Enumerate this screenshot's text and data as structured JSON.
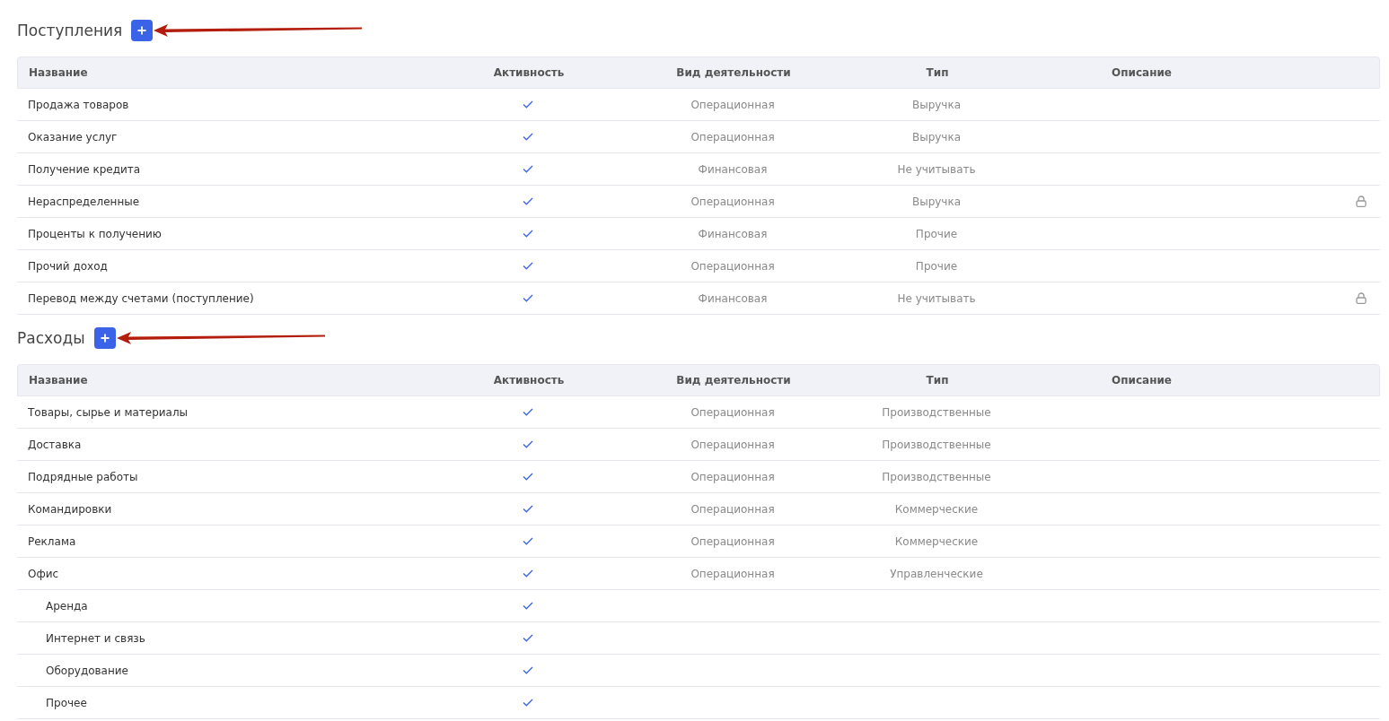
{
  "sections": [
    {
      "title": "Поступления",
      "columns": [
        "Название",
        "Активность",
        "Вид деятельности",
        "Тип",
        "Описание"
      ],
      "rows": [
        {
          "name": "Продажа товаров",
          "active": true,
          "activity": "Операционная",
          "type": "Выручка",
          "locked": false
        },
        {
          "name": "Оказание услуг",
          "active": true,
          "activity": "Операционная",
          "type": "Выручка",
          "locked": false
        },
        {
          "name": "Получение кредита",
          "active": true,
          "activity": "Финансовая",
          "type": "Не учитывать",
          "locked": false
        },
        {
          "name": "Нераспределенные",
          "active": true,
          "activity": "Операционная",
          "type": "Выручка",
          "locked": true
        },
        {
          "name": "Проценты к получению",
          "active": true,
          "activity": "Финансовая",
          "type": "Прочие",
          "locked": false
        },
        {
          "name": "Прочий доход",
          "active": true,
          "activity": "Операционная",
          "type": "Прочие",
          "locked": false
        },
        {
          "name": "Перевод между счетами (поступление)",
          "active": true,
          "activity": "Финансовая",
          "type": "Не учитывать",
          "locked": true
        }
      ]
    },
    {
      "title": "Расходы",
      "columns": [
        "Название",
        "Активность",
        "Вид деятельности",
        "Тип",
        "Описание"
      ],
      "rows": [
        {
          "name": "Товары, сырье и материалы",
          "active": true,
          "activity": "Операционная",
          "type": "Производственные",
          "locked": false
        },
        {
          "name": "Доставка",
          "active": true,
          "activity": "Операционная",
          "type": "Производственные",
          "locked": false
        },
        {
          "name": "Подрядные работы",
          "active": true,
          "activity": "Операционная",
          "type": "Производственные",
          "locked": false
        },
        {
          "name": "Командировки",
          "active": true,
          "activity": "Операционная",
          "type": "Коммерческие",
          "locked": false
        },
        {
          "name": "Реклама",
          "active": true,
          "activity": "Операционная",
          "type": "Коммерческие",
          "locked": false
        },
        {
          "name": "Офис",
          "active": true,
          "activity": "Операционная",
          "type": "Управленческие",
          "locked": false,
          "children": [
            {
              "name": "Аренда",
              "active": true,
              "locked": false
            },
            {
              "name": "Интернет и связь",
              "active": true,
              "locked": false
            },
            {
              "name": "Оборудование",
              "active": true,
              "locked": false
            },
            {
              "name": "Прочее",
              "active": true,
              "locked": false
            }
          ]
        }
      ]
    }
  ]
}
